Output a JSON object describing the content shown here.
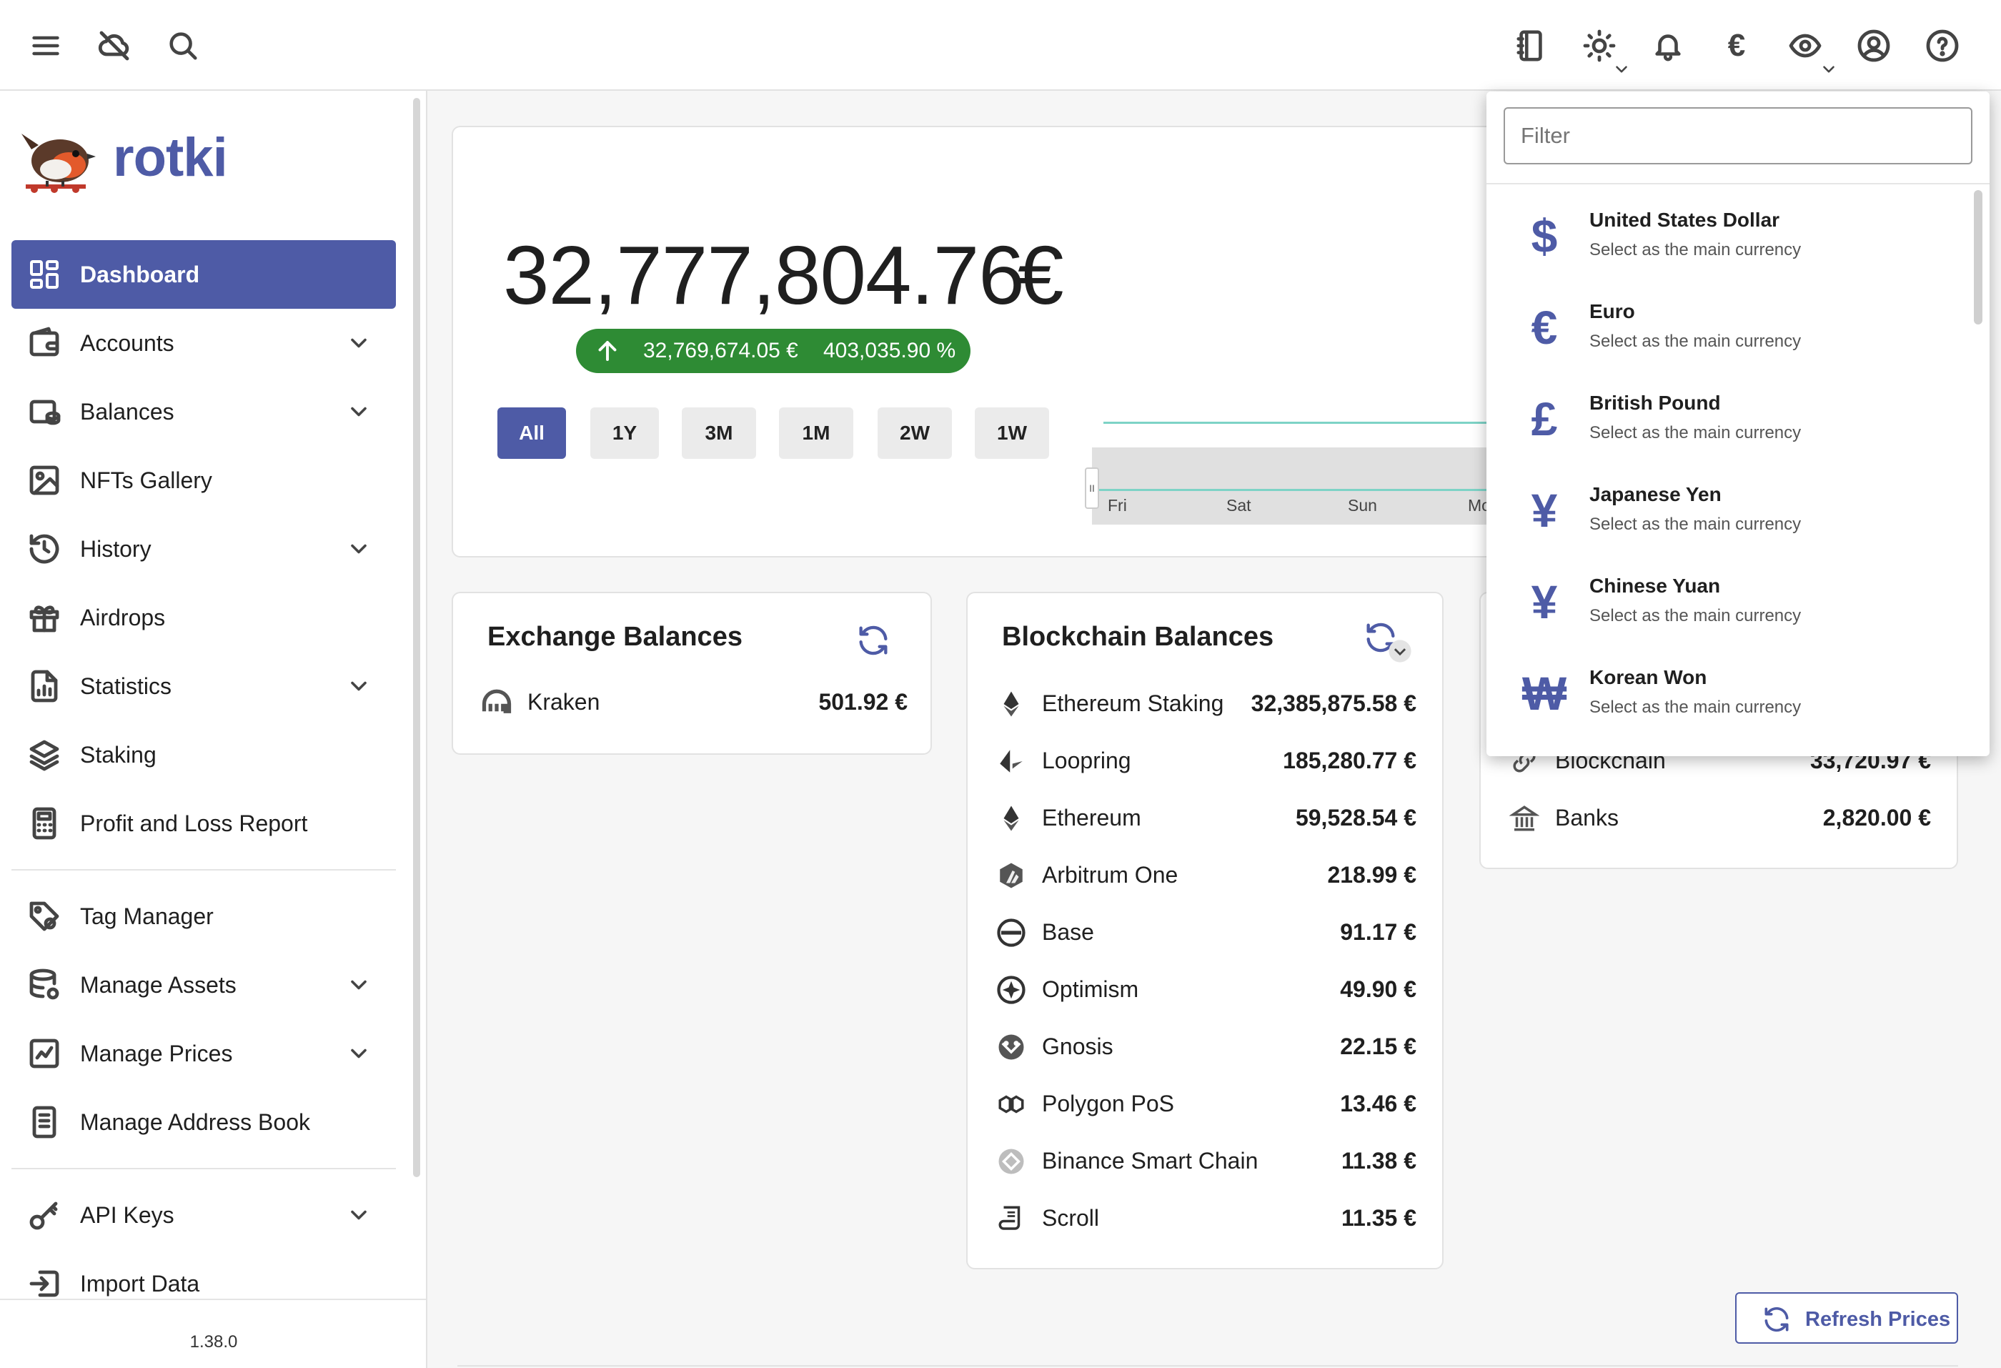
{
  "app": {
    "name": "rotki",
    "version": "1.38.0"
  },
  "topbar": {
    "left_icons": [
      "menu-icon",
      "cloud-off-icon",
      "search-icon"
    ],
    "right_icons": [
      "notes-icon",
      "theme-icon",
      "bell-icon",
      "euro-icon",
      "eye-icon",
      "account-icon",
      "help-icon"
    ],
    "currency_symbol": "€"
  },
  "sidebar": {
    "items": [
      {
        "label": "Dashboard",
        "icon": "dashboard-icon",
        "active": true,
        "expandable": false
      },
      {
        "label": "Accounts",
        "icon": "wallet-icon",
        "active": false,
        "expandable": true
      },
      {
        "label": "Balances",
        "icon": "balances-icon",
        "active": false,
        "expandable": true
      },
      {
        "label": "NFTs Gallery",
        "icon": "image-icon",
        "active": false,
        "expandable": false
      },
      {
        "label": "History",
        "icon": "history-icon",
        "active": false,
        "expandable": true
      },
      {
        "label": "Airdrops",
        "icon": "gift-icon",
        "active": false,
        "expandable": false
      },
      {
        "label": "Statistics",
        "icon": "statistics-icon",
        "active": false,
        "expandable": true
      },
      {
        "label": "Staking",
        "icon": "layers-icon",
        "active": false,
        "expandable": false
      },
      {
        "label": "Profit and Loss Report",
        "icon": "calculator-icon",
        "active": false,
        "expandable": false
      },
      {
        "label": "Tag Manager",
        "icon": "tag-icon",
        "active": false,
        "expandable": false
      },
      {
        "label": "Manage Assets",
        "icon": "database-icon",
        "active": false,
        "expandable": true
      },
      {
        "label": "Manage Prices",
        "icon": "price-chart-icon",
        "active": false,
        "expandable": true
      },
      {
        "label": "Manage Address Book",
        "icon": "address-book-icon",
        "active": false,
        "expandable": false
      },
      {
        "label": "API Keys",
        "icon": "key-icon",
        "active": false,
        "expandable": true
      },
      {
        "label": "Import Data",
        "icon": "import-icon",
        "active": false,
        "expandable": false
      }
    ]
  },
  "overview": {
    "total": "32,777,804.76",
    "currency": "€",
    "change_amount": "32,769,674.05 €",
    "change_percent": "403,035.90 %",
    "ranges": [
      "All",
      "1Y",
      "3M",
      "1M",
      "2W",
      "1W"
    ],
    "active_range": "All",
    "chart_ticks": [
      "Fri",
      "Sat",
      "Sun",
      "Mo"
    ]
  },
  "exchange_balances": {
    "title": "Exchange Balances",
    "rows": [
      {
        "name": "Kraken",
        "value": "501.92 €",
        "icon": "kraken-icon"
      }
    ]
  },
  "blockchain_balances": {
    "title": "Blockchain Balances",
    "rows": [
      {
        "name": "Ethereum Staking",
        "value": "32,385,875.58 €",
        "icon": "ethereum-icon"
      },
      {
        "name": "Loopring",
        "value": "185,280.77 €",
        "icon": "loopring-icon"
      },
      {
        "name": "Ethereum",
        "value": "59,528.54 €",
        "icon": "ethereum-icon"
      },
      {
        "name": "Arbitrum One",
        "value": "218.99 €",
        "icon": "arbitrum-icon"
      },
      {
        "name": "Base",
        "value": "91.17 €",
        "icon": "base-icon"
      },
      {
        "name": "Optimism",
        "value": "49.90 €",
        "icon": "optimism-icon"
      },
      {
        "name": "Gnosis",
        "value": "22.15 €",
        "icon": "gnosis-icon"
      },
      {
        "name": "Polygon PoS",
        "value": "13.46 €",
        "icon": "polygon-icon"
      },
      {
        "name": "Binance Smart Chain",
        "value": "11.38 €",
        "icon": "bsc-icon"
      },
      {
        "name": "Scroll",
        "value": "11.35 €",
        "icon": "scroll-icon"
      }
    ]
  },
  "manual_balances": {
    "rows": [
      {
        "name": "Blockchain",
        "value": "33,720.97 €",
        "icon": "link-icon"
      },
      {
        "name": "Banks",
        "value": "2,820.00 €",
        "icon": "bank-icon"
      }
    ]
  },
  "refresh_prices": {
    "label": "Refresh Prices"
  },
  "currency_menu": {
    "filter_placeholder": "Filter",
    "items": [
      {
        "symbol": "$",
        "name": "United States Dollar",
        "subtitle": "Select as the main currency"
      },
      {
        "symbol": "€",
        "name": "Euro",
        "subtitle": "Select as the main currency"
      },
      {
        "symbol": "£",
        "name": "British Pound",
        "subtitle": "Select as the main currency"
      },
      {
        "symbol": "¥",
        "name": "Japanese Yen",
        "subtitle": "Select as the main currency"
      },
      {
        "symbol": "¥",
        "name": "Chinese Yuan",
        "subtitle": "Select as the main currency"
      },
      {
        "symbol": "₩",
        "name": "Korean Won",
        "subtitle": "Select as the main currency"
      }
    ]
  },
  "colors": {
    "accent": "#4e5ba6",
    "positive": "#2e8b34",
    "chart_line": "#7dd3c6"
  }
}
